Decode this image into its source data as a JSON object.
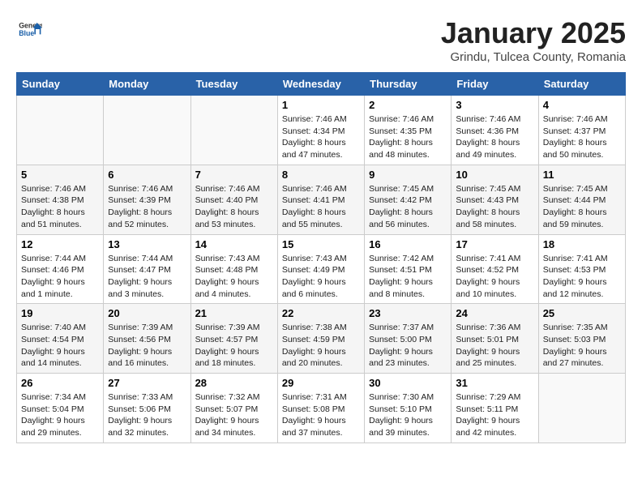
{
  "header": {
    "logo_general": "General",
    "logo_blue": "Blue",
    "month_title": "January 2025",
    "location": "Grindu, Tulcea County, Romania"
  },
  "weekdays": [
    "Sunday",
    "Monday",
    "Tuesday",
    "Wednesday",
    "Thursday",
    "Friday",
    "Saturday"
  ],
  "weeks": [
    [
      {
        "day": "",
        "info": ""
      },
      {
        "day": "",
        "info": ""
      },
      {
        "day": "",
        "info": ""
      },
      {
        "day": "1",
        "info": "Sunrise: 7:46 AM\nSunset: 4:34 PM\nDaylight: 8 hours and 47 minutes."
      },
      {
        "day": "2",
        "info": "Sunrise: 7:46 AM\nSunset: 4:35 PM\nDaylight: 8 hours and 48 minutes."
      },
      {
        "day": "3",
        "info": "Sunrise: 7:46 AM\nSunset: 4:36 PM\nDaylight: 8 hours and 49 minutes."
      },
      {
        "day": "4",
        "info": "Sunrise: 7:46 AM\nSunset: 4:37 PM\nDaylight: 8 hours and 50 minutes."
      }
    ],
    [
      {
        "day": "5",
        "info": "Sunrise: 7:46 AM\nSunset: 4:38 PM\nDaylight: 8 hours and 51 minutes."
      },
      {
        "day": "6",
        "info": "Sunrise: 7:46 AM\nSunset: 4:39 PM\nDaylight: 8 hours and 52 minutes."
      },
      {
        "day": "7",
        "info": "Sunrise: 7:46 AM\nSunset: 4:40 PM\nDaylight: 8 hours and 53 minutes."
      },
      {
        "day": "8",
        "info": "Sunrise: 7:46 AM\nSunset: 4:41 PM\nDaylight: 8 hours and 55 minutes."
      },
      {
        "day": "9",
        "info": "Sunrise: 7:45 AM\nSunset: 4:42 PM\nDaylight: 8 hours and 56 minutes."
      },
      {
        "day": "10",
        "info": "Sunrise: 7:45 AM\nSunset: 4:43 PM\nDaylight: 8 hours and 58 minutes."
      },
      {
        "day": "11",
        "info": "Sunrise: 7:45 AM\nSunset: 4:44 PM\nDaylight: 8 hours and 59 minutes."
      }
    ],
    [
      {
        "day": "12",
        "info": "Sunrise: 7:44 AM\nSunset: 4:46 PM\nDaylight: 9 hours and 1 minute."
      },
      {
        "day": "13",
        "info": "Sunrise: 7:44 AM\nSunset: 4:47 PM\nDaylight: 9 hours and 3 minutes."
      },
      {
        "day": "14",
        "info": "Sunrise: 7:43 AM\nSunset: 4:48 PM\nDaylight: 9 hours and 4 minutes."
      },
      {
        "day": "15",
        "info": "Sunrise: 7:43 AM\nSunset: 4:49 PM\nDaylight: 9 hours and 6 minutes."
      },
      {
        "day": "16",
        "info": "Sunrise: 7:42 AM\nSunset: 4:51 PM\nDaylight: 9 hours and 8 minutes."
      },
      {
        "day": "17",
        "info": "Sunrise: 7:41 AM\nSunset: 4:52 PM\nDaylight: 9 hours and 10 minutes."
      },
      {
        "day": "18",
        "info": "Sunrise: 7:41 AM\nSunset: 4:53 PM\nDaylight: 9 hours and 12 minutes."
      }
    ],
    [
      {
        "day": "19",
        "info": "Sunrise: 7:40 AM\nSunset: 4:54 PM\nDaylight: 9 hours and 14 minutes."
      },
      {
        "day": "20",
        "info": "Sunrise: 7:39 AM\nSunset: 4:56 PM\nDaylight: 9 hours and 16 minutes."
      },
      {
        "day": "21",
        "info": "Sunrise: 7:39 AM\nSunset: 4:57 PM\nDaylight: 9 hours and 18 minutes."
      },
      {
        "day": "22",
        "info": "Sunrise: 7:38 AM\nSunset: 4:59 PM\nDaylight: 9 hours and 20 minutes."
      },
      {
        "day": "23",
        "info": "Sunrise: 7:37 AM\nSunset: 5:00 PM\nDaylight: 9 hours and 23 minutes."
      },
      {
        "day": "24",
        "info": "Sunrise: 7:36 AM\nSunset: 5:01 PM\nDaylight: 9 hours and 25 minutes."
      },
      {
        "day": "25",
        "info": "Sunrise: 7:35 AM\nSunset: 5:03 PM\nDaylight: 9 hours and 27 minutes."
      }
    ],
    [
      {
        "day": "26",
        "info": "Sunrise: 7:34 AM\nSunset: 5:04 PM\nDaylight: 9 hours and 29 minutes."
      },
      {
        "day": "27",
        "info": "Sunrise: 7:33 AM\nSunset: 5:06 PM\nDaylight: 9 hours and 32 minutes."
      },
      {
        "day": "28",
        "info": "Sunrise: 7:32 AM\nSunset: 5:07 PM\nDaylight: 9 hours and 34 minutes."
      },
      {
        "day": "29",
        "info": "Sunrise: 7:31 AM\nSunset: 5:08 PM\nDaylight: 9 hours and 37 minutes."
      },
      {
        "day": "30",
        "info": "Sunrise: 7:30 AM\nSunset: 5:10 PM\nDaylight: 9 hours and 39 minutes."
      },
      {
        "day": "31",
        "info": "Sunrise: 7:29 AM\nSunset: 5:11 PM\nDaylight: 9 hours and 42 minutes."
      },
      {
        "day": "",
        "info": ""
      }
    ]
  ]
}
